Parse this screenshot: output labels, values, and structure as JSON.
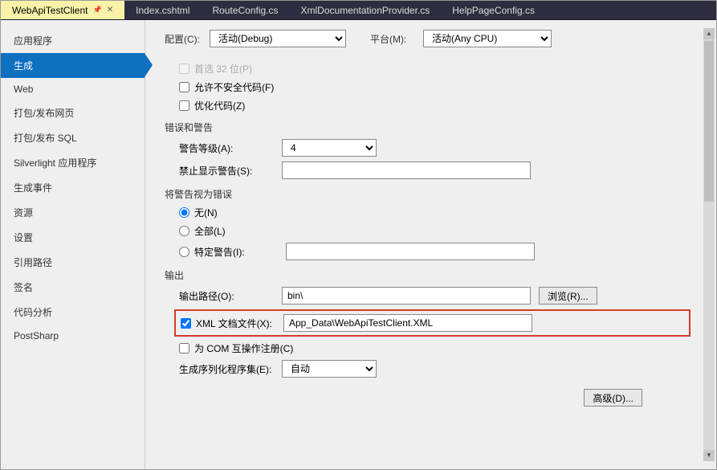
{
  "tabs": [
    {
      "label": "WebApiTestClient",
      "active": true
    },
    {
      "label": "Index.cshtml"
    },
    {
      "label": "RouteConfig.cs"
    },
    {
      "label": "XmlDocumentationProvider.cs"
    },
    {
      "label": "HelpPageConfig.cs"
    }
  ],
  "sidebar": {
    "items": [
      "应用程序",
      "生成",
      "Web",
      "打包/发布网页",
      "打包/发布 SQL",
      "Silverlight 应用程序",
      "生成事件",
      "资源",
      "设置",
      "引用路径",
      "签名",
      "代码分析",
      "PostSharp"
    ],
    "activeIndex": 1
  },
  "top": {
    "config_label": "配置(C):",
    "config_value": "活动(Debug)",
    "platform_label": "平台(M):",
    "platform_value": "活动(Any CPU)"
  },
  "general": {
    "prefer32_label": "首选 32 位(P)",
    "allow_unsafe_label": "允许不安全代码(F)",
    "optimize_label": "优化代码(Z)"
  },
  "errors": {
    "header": "错误和警告",
    "warn_level_label": "警告等级(A):",
    "warn_level_value": "4",
    "suppress_label": "禁止显示警告(S):",
    "suppress_value": ""
  },
  "treat": {
    "header": "将警告视为错误",
    "none_label": "无(N)",
    "all_label": "全部(L)",
    "specific_label": "特定警告(I):",
    "specific_value": ""
  },
  "output": {
    "header": "输出",
    "path_label": "输出路径(O):",
    "path_value": "bin\\",
    "browse_btn": "浏览(R)...",
    "xml_doc_label": "XML 文档文件(X):",
    "xml_doc_value": "App_Data\\WebApiTestClient.XML",
    "xml_doc_checked": true,
    "com_label": "为 COM 互操作注册(C)",
    "serialize_label": "生成序列化程序集(E):",
    "serialize_value": "自动",
    "advanced_btn": "高级(D)..."
  }
}
